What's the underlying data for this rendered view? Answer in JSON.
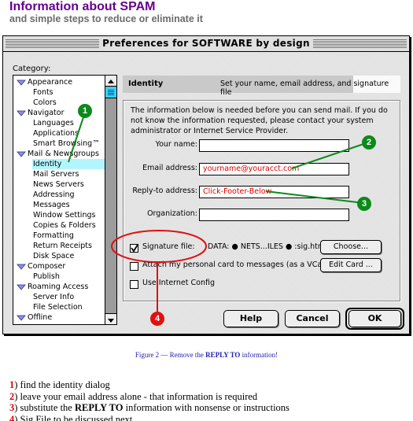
{
  "header": {
    "title": "Information about SPAM",
    "subtitle": "and simple steps to reduce or eliminate it"
  },
  "window": {
    "title": "Preferences for SOFTWARE by design",
    "category_label": "Category:",
    "categories": [
      {
        "label": "Appearance",
        "level": 0,
        "expanded": true
      },
      {
        "label": "Fonts",
        "level": 1
      },
      {
        "label": "Colors",
        "level": 1
      },
      {
        "label": "Navigator",
        "level": 0,
        "expanded": true
      },
      {
        "label": "Languages",
        "level": 1
      },
      {
        "label": "Applications",
        "level": 1
      },
      {
        "label": "Smart Browsing™",
        "level": 1
      },
      {
        "label": "Mail & Newsgroups",
        "level": 0,
        "expanded": true
      },
      {
        "label": "Identity",
        "level": 1,
        "selected": true
      },
      {
        "label": "Mail Servers",
        "level": 1
      },
      {
        "label": "News Servers",
        "level": 1
      },
      {
        "label": "Addressing",
        "level": 1
      },
      {
        "label": "Messages",
        "level": 1
      },
      {
        "label": "Window Settings",
        "level": 1
      },
      {
        "label": "Copies & Folders",
        "level": 1
      },
      {
        "label": "Formatting",
        "level": 1
      },
      {
        "label": "Return Receipts",
        "level": 1
      },
      {
        "label": "Disk Space",
        "level": 1
      },
      {
        "label": "Composer",
        "level": 0,
        "expanded": true
      },
      {
        "label": "Publish",
        "level": 1
      },
      {
        "label": "Roaming Access",
        "level": 0,
        "expanded": true
      },
      {
        "label": "Server Info",
        "level": 1
      },
      {
        "label": "File Selection",
        "level": 1
      },
      {
        "label": "Offline",
        "level": 0,
        "expanded": true
      }
    ],
    "panel": {
      "title": "Identity",
      "description": "Set your name, email address, and signature file",
      "intro": "The information below is needed before you can send mail. If you do not know the information requested, please contact your system administrator or Internet Service Provider.",
      "fields": {
        "name": {
          "label": "Your name:",
          "value": ""
        },
        "email": {
          "label": "Email address:",
          "value": "yourname@youracct.com"
        },
        "reply_to": {
          "label": "Reply-to address:",
          "value": "Click-Footer-Below"
        },
        "organization": {
          "label": "Organization:",
          "value": ""
        }
      },
      "signature": {
        "label": "Signature file:",
        "checked": true,
        "path": "DATA: ● NETS...ILES ● :sig.html",
        "button": "Choose..."
      },
      "vcard": {
        "label": "Attach my personal card to messages (as a VCard)",
        "checked": false,
        "button": "Edit Card ..."
      },
      "internet_config": {
        "label": "Use Internet Config",
        "checked": false
      }
    },
    "buttons": {
      "help": "Help",
      "cancel": "Cancel",
      "ok": "OK"
    }
  },
  "annotations": {
    "badges": [
      "1",
      "2",
      "3",
      "4"
    ],
    "colors": {
      "green": "#0b8a1a",
      "red": "#e01010"
    }
  },
  "caption": {
    "prefix": "Figure 2 — Remove the ",
    "bold": "REPLY TO",
    "suffix": " information!"
  },
  "steps": [
    {
      "num": "1",
      "text": ") find the identity dialog"
    },
    {
      "num": "2",
      "text": ") leave your email address alone - that information is required"
    },
    {
      "num": "3",
      "pre": ") substitute the ",
      "bold": "REPLY TO",
      "text": " information with nonsense or instructions"
    },
    {
      "num": "4",
      "text": ") Sig File to be discussed next"
    }
  ]
}
